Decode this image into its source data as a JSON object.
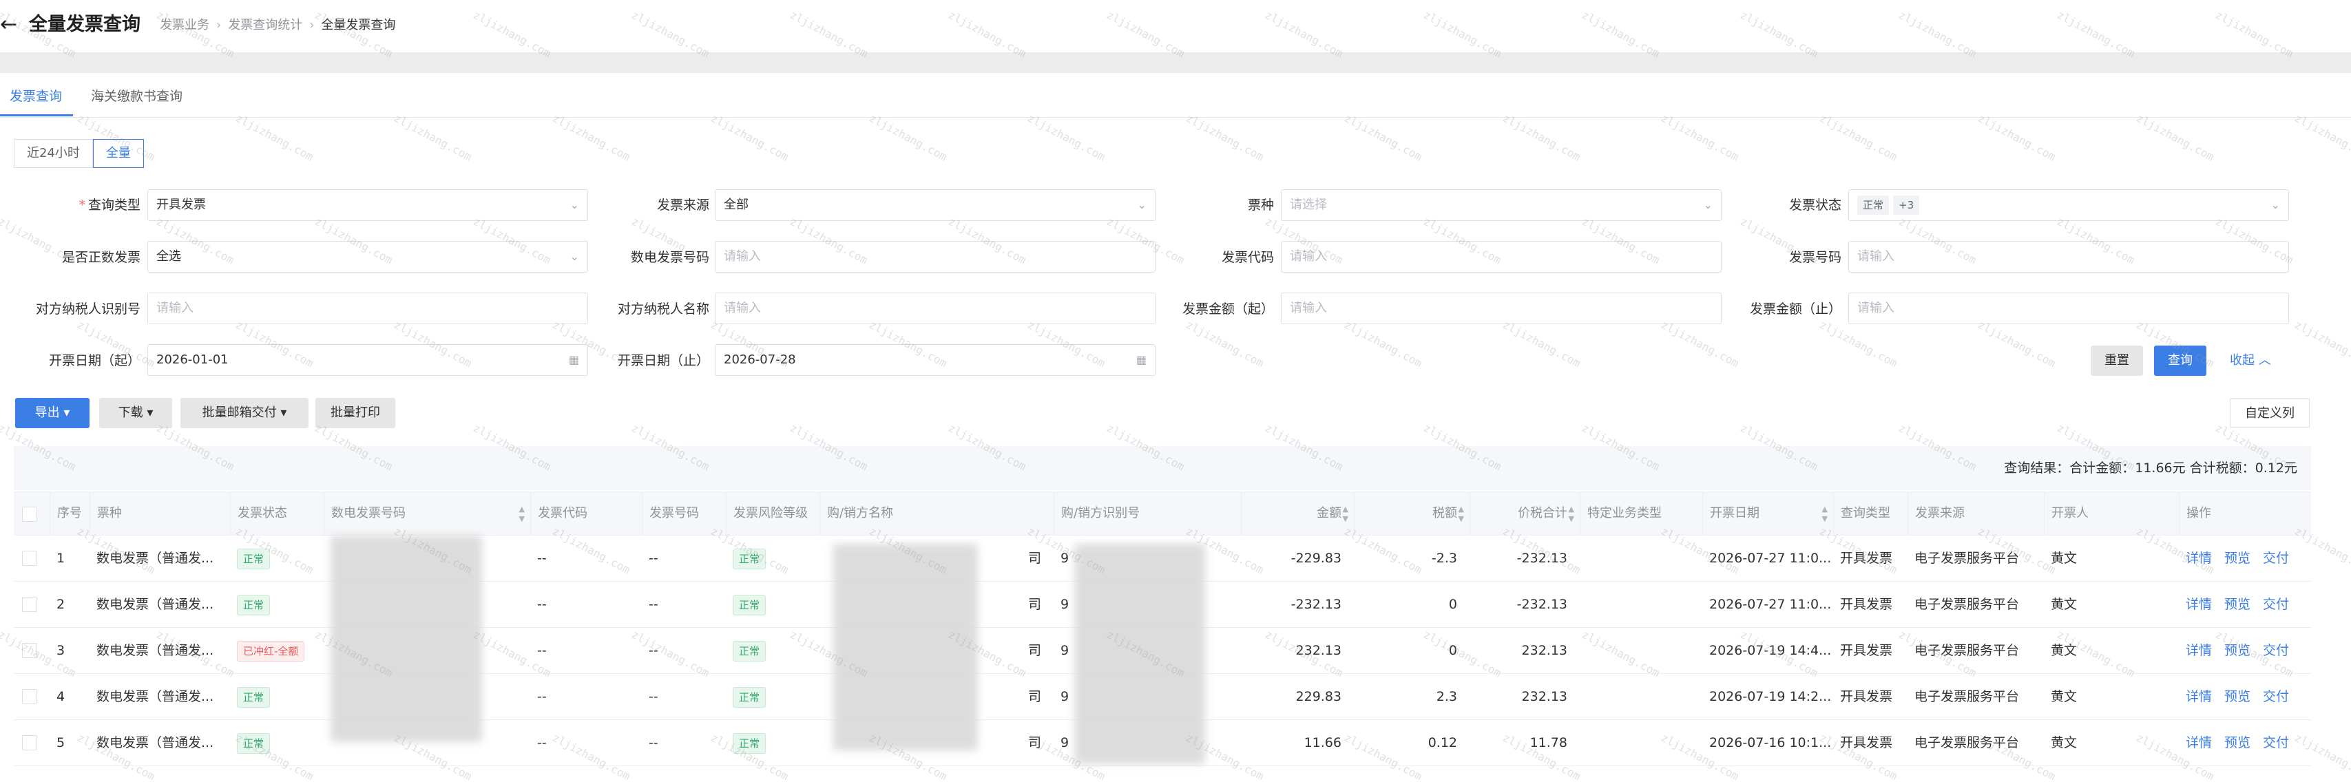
{
  "header": {
    "back_icon": "arrow-left-icon",
    "title": "全量发票查询",
    "breadcrumb": [
      "发票业务",
      "发票查询统计",
      "全量发票查询"
    ]
  },
  "tabs": [
    "发票查询",
    "海关缴款书查询"
  ],
  "range_buttons": [
    "近24小时",
    "全量"
  ],
  "filters": {
    "query_type": {
      "label": "查询类型",
      "value": "开具发票"
    },
    "invoice_source": {
      "label": "发票来源",
      "value": "全部"
    },
    "ticket_kind": {
      "label": "票种",
      "placeholder": "请选择"
    },
    "invoice_status": {
      "label": "发票状态",
      "tag": "正常",
      "more": "+3"
    },
    "is_positive": {
      "label": "是否正数发票",
      "value": "全选"
    },
    "digital_no": {
      "label": "数电发票号码",
      "placeholder": "请输入"
    },
    "invoice_code": {
      "label": "发票代码",
      "placeholder": "请输入"
    },
    "invoice_no": {
      "label": "发票号码",
      "placeholder": "请输入"
    },
    "counterparty_id": {
      "label": "对方纳税人识别号",
      "placeholder": "请输入"
    },
    "counterparty_name": {
      "label": "对方纳税人名称",
      "placeholder": "请输入"
    },
    "amount_from": {
      "label": "发票金额（起）",
      "placeholder": "请输入"
    },
    "amount_to": {
      "label": "发票金额（止）",
      "placeholder": "请输入"
    },
    "date_from": {
      "label": "开票日期（起）",
      "value": "2026-01-01"
    },
    "date_to": {
      "label": "开票日期（止）",
      "value": "2026-07-28"
    }
  },
  "actions": {
    "reset": "重置",
    "search": "查询",
    "collapse": "收起",
    "export": "导出",
    "download": "下载",
    "batch_email": "批量邮箱交付",
    "batch_print": "批量打印",
    "custom_columns": "自定义列"
  },
  "summary": "查询结果：合计金额：11.66元    合计税额：0.12元",
  "table": {
    "columns": [
      "序号",
      "票种",
      "发票状态",
      "数电发票号码",
      "发票代码",
      "发票号码",
      "发票风险等级",
      "购/销方名称",
      "购/销方识别号",
      "金额",
      "税额",
      "价税合计",
      "特定业务类型",
      "开票日期",
      "查询类型",
      "发票来源",
      "开票人",
      "操作"
    ],
    "rows": [
      {
        "no": "1",
        "kind": "数电发票（普通发...",
        "status": "正常",
        "code": "--",
        "number": "--",
        "risk": "正常",
        "name_tail": "司",
        "id_head": "9",
        "amount": "-229.83",
        "tax": "-2.3",
        "total": "-232.13",
        "date": "2026-07-27 11:0...",
        "qtype": "开具发票",
        "source": "电子发票服务平台",
        "issuer": "黄文"
      },
      {
        "no": "2",
        "kind": "数电发票（普通发...",
        "status": "正常",
        "code": "--",
        "number": "--",
        "risk": "正常",
        "name_tail": "司",
        "id_head": "9",
        "amount": "-232.13",
        "tax": "0",
        "total": "-232.13",
        "date": "2026-07-27 11:0...",
        "qtype": "开具发票",
        "source": "电子发票服务平台",
        "issuer": "黄文"
      },
      {
        "no": "3",
        "kind": "数电发票（普通发...",
        "status": "已冲红-全额",
        "code": "--",
        "number": "--",
        "risk": "正常",
        "name_tail": "司",
        "id_head": "9",
        "amount": "232.13",
        "tax": "0",
        "total": "232.13",
        "date": "2026-07-19 14:4...",
        "qtype": "开具发票",
        "source": "电子发票服务平台",
        "issuer": "黄文"
      },
      {
        "no": "4",
        "kind": "数电发票（普通发...",
        "status": "正常",
        "code": "--",
        "number": "--",
        "risk": "正常",
        "name_tail": "司",
        "id_head": "9",
        "amount": "229.83",
        "tax": "2.3",
        "total": "232.13",
        "date": "2026-07-19 14:2...",
        "qtype": "开具发票",
        "source": "电子发票服务平台",
        "issuer": "黄文"
      },
      {
        "no": "5",
        "kind": "数电发票（普通发...",
        "status": "正常",
        "code": "--",
        "number": "--",
        "risk": "正常",
        "name_tail": "司",
        "id_head": "9",
        "amount": "11.66",
        "tax": "0.12",
        "total": "11.78",
        "date": "2026-07-16 10:1...",
        "qtype": "开具发票",
        "source": "电子发票服务平台",
        "issuer": "黄文"
      }
    ],
    "row_ops": [
      "详情",
      "预览",
      "交付"
    ]
  },
  "watermark_text": "zljizhang.com",
  "colors": {
    "primary": "#3a7ee6",
    "normal_tag": "#2fa86b",
    "red_tag": "#e85a5a"
  }
}
